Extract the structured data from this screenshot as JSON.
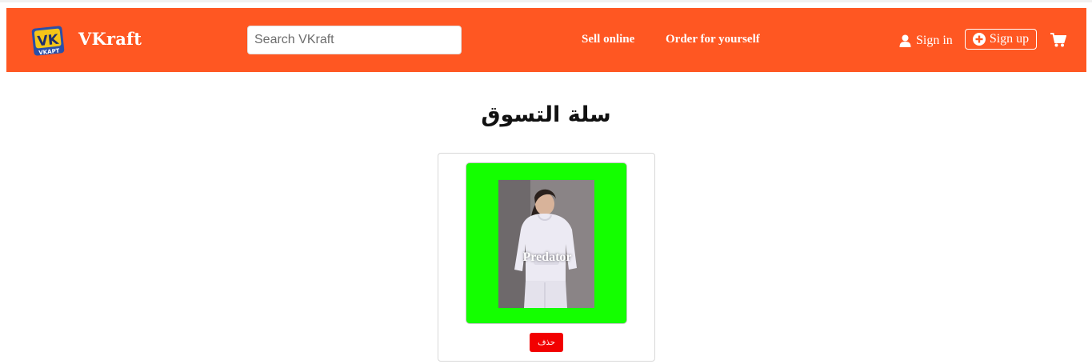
{
  "header": {
    "brand": "VKraft",
    "logo_text_top": "VK",
    "logo_text_bottom": "VKAPT",
    "search_placeholder": "Search VKraft",
    "nav": [
      {
        "label": "Sell online"
      },
      {
        "label": "Order for yourself"
      }
    ],
    "signin_label": "Sign in",
    "signup_label": "Sign up",
    "icons": {
      "signin": "user-icon",
      "signup": "plus-circle-icon",
      "cart": "cart-icon"
    }
  },
  "main": {
    "title": "سلة التسوق",
    "items": [
      {
        "name": "Predator",
        "delete_label": "حذف"
      }
    ]
  },
  "colors": {
    "navbar": "#ff5722",
    "card_background": "#14ff00",
    "delete_button": "#f20000"
  }
}
